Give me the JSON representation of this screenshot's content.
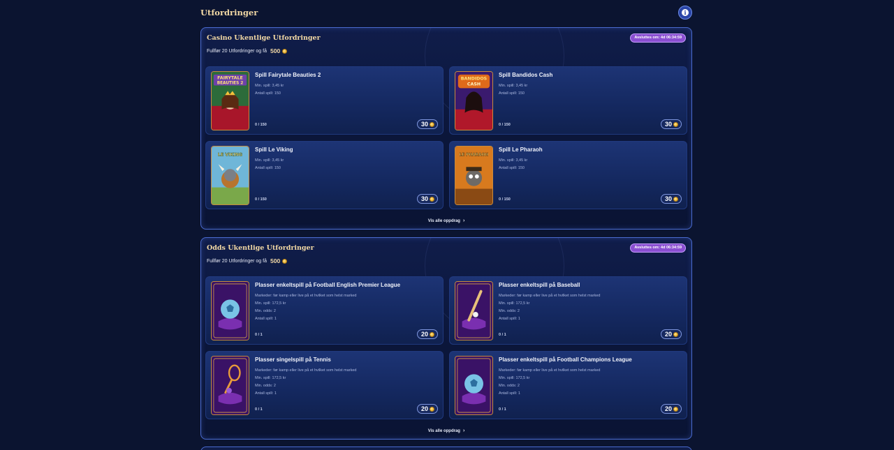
{
  "page": {
    "title": "Utfordringer",
    "info_icon": "info-icon"
  },
  "sections": [
    {
      "title": "Casino Ukentlige Utfordringer",
      "timer": "Avsluttes om: 4d 06:34:59",
      "reward_prefix": "Fullfør 20 Utfordringer og få",
      "reward_amount": "500",
      "view_all": "Vis alle oppdrag",
      "cards": [
        {
          "title": "Spill Fairytale Beauties 2",
          "details": [
            "Min. spill: 3,45 kr",
            "Antall spill: 150"
          ],
          "progress": "0 / 150",
          "points": "30",
          "thumb": "fairytale"
        },
        {
          "title": "Spill Bandidos Cash",
          "details": [
            "Min. spill: 3,45 kr",
            "Antall spill: 150"
          ],
          "progress": "0 / 150",
          "points": "30",
          "thumb": "bandidos"
        },
        {
          "title": "Spill Le Viking",
          "details": [
            "Min. spill: 3,45 kr",
            "Antall spill: 150"
          ],
          "progress": "0 / 150",
          "points": "30",
          "thumb": "viking"
        },
        {
          "title": "Spill Le Pharaoh",
          "details": [
            "Min. spill: 3,45 kr",
            "Antall spill: 150"
          ],
          "progress": "0 / 150",
          "points": "30",
          "thumb": "pharaoh"
        }
      ]
    },
    {
      "title": "Odds Ukentlige Utfordringer",
      "timer": "Avsluttes om: 4d 06:34:59",
      "reward_prefix": "Fullfør 20 Utfordringer og få",
      "reward_amount": "500",
      "view_all": "Vis alle oppdrag",
      "cards": [
        {
          "title": "Plasser enkeltspill på Football English Premier League",
          "details": [
            "Markeder: før kamp eller live på et hvilket som helst marked",
            "Min. spill: 172,5 kr",
            "Min. odds: 2",
            "Antall spill: 1"
          ],
          "progress": "0 / 1",
          "points": "20",
          "thumb": "football"
        },
        {
          "title": "Plasser enkeltspill på Baseball",
          "details": [
            "Markeder: før kamp eller live på et hvilket som helst marked",
            "Min. spill: 172,5 kr",
            "Min. odds: 2",
            "Antall spill: 1"
          ],
          "progress": "0 / 1",
          "points": "20",
          "thumb": "baseball"
        },
        {
          "title": "Plasser singelspill på Tennis",
          "details": [
            "Markeder: før kamp eller live på et hvilket som helst marked",
            "Min. spill: 172,5 kr",
            "Min. odds: 2",
            "Antall spill: 1"
          ],
          "progress": "0 / 1",
          "points": "20",
          "thumb": "tennis"
        },
        {
          "title": "Plasser enkeltspill på Football Champions League",
          "details": [
            "Markeder: før kamp eller live på et hvilket som helst marked",
            "Min. spill: 172,5 kr",
            "Min. odds: 2",
            "Antall spill: 1"
          ],
          "progress": "0 / 1",
          "points": "20",
          "thumb": "football"
        }
      ]
    }
  ],
  "thumb_text": {
    "fairytale": [
      "FAIRYTALE",
      "BEAUTIES 2"
    ],
    "bandidos": [
      "BANDIDOS",
      "CASH"
    ],
    "viking": [
      "LE VIKING"
    ],
    "pharaoh": [
      "LE PHARAOH"
    ]
  },
  "colors": {
    "accent_gold": "#f3d9a5",
    "timer_purple": "#8a4fd1",
    "card_blue": "#1d3475",
    "border_blue": "#4a6bd0"
  }
}
